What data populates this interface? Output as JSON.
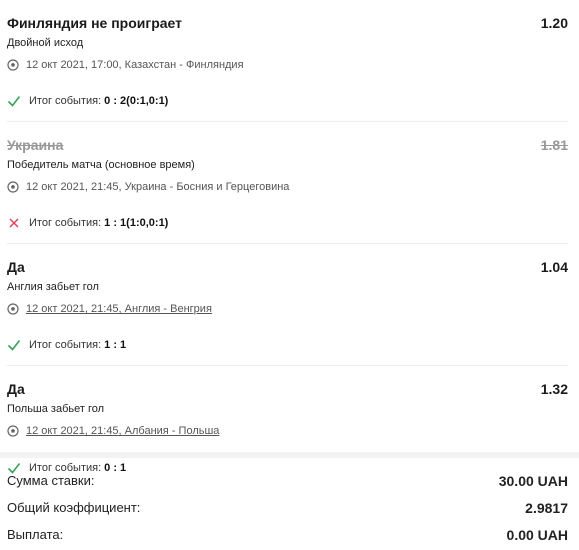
{
  "bets": [
    {
      "pick": "Финляндия не проиграет",
      "odds": "1.20",
      "market": "Двойной исход",
      "event": "12 окт 2021, 17:00, Казахстан - Финляндия",
      "result_label": "Итог события:",
      "result_score": "0 : 2(0:1,0:1)",
      "status": "won",
      "voided": false,
      "event_link": false
    },
    {
      "pick": "Украина",
      "odds": "1.81",
      "market": "Победитель матча (основное время)",
      "event": "12 окт 2021, 21:45, Украина - Босния и Герцеговина",
      "result_label": "Итог события:",
      "result_score": "1 : 1(1:0,0:1)",
      "status": "lost",
      "voided": true,
      "event_link": false
    },
    {
      "pick": "Да",
      "odds": "1.04",
      "market": "Англия забьет гол",
      "event": "12 окт 2021, 21:45, Англия - Венгрия",
      "result_label": "Итог события:",
      "result_score": "1 : 1",
      "status": "won",
      "voided": false,
      "event_link": true
    },
    {
      "pick": "Да",
      "odds": "1.32",
      "market": "Польша забьет гол",
      "event": "12 окт 2021, 21:45, Албания - Польша",
      "result_label": "Итог события:",
      "result_score": "0 : 1",
      "status": "won",
      "voided": false,
      "event_link": true
    }
  ],
  "summary": {
    "stake_label": "Сумма ставки:",
    "stake_value": "30.00 UAH",
    "coef_label": "Общий коэффициент:",
    "coef_value": "2.9817",
    "payout_label": "Выплата:",
    "payout_value": "0.00 UAH"
  },
  "colors": {
    "won": "#3aa05a",
    "lost": "#e0455c",
    "divider": "#ececec"
  },
  "icons": {
    "event": "soccer-ball-icon",
    "won": "checkmark-icon",
    "lost": "cross-icon"
  }
}
